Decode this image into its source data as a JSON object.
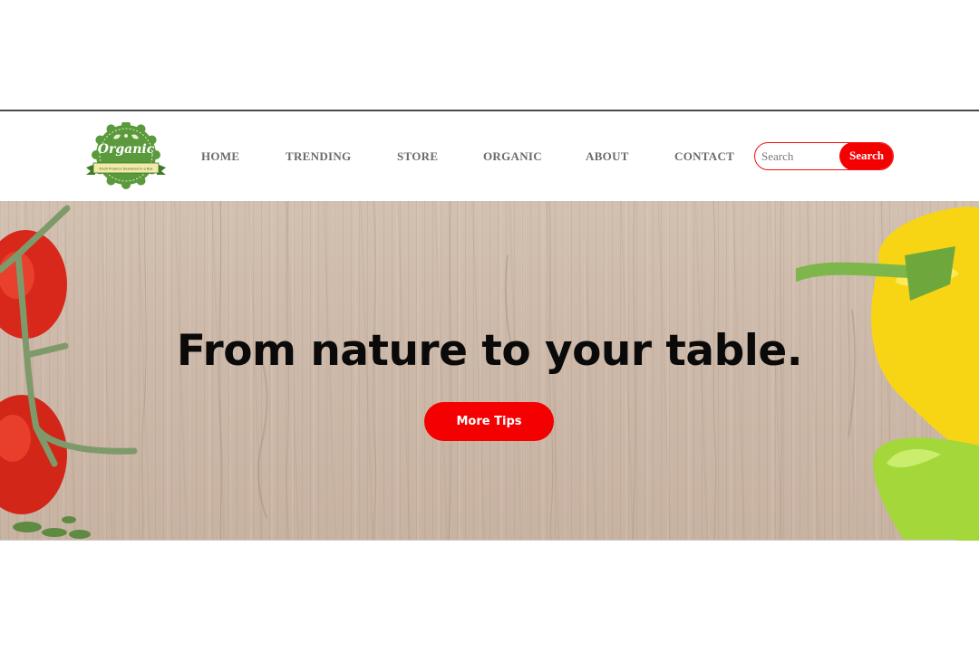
{
  "brand": {
    "logo_text": "Organic",
    "logo_tagline": "Fresh Produce Delivered in a Box"
  },
  "nav": {
    "items": [
      {
        "label": "HOME"
      },
      {
        "label": "TRENDING"
      },
      {
        "label": "STORE"
      },
      {
        "label": "ORGANIC"
      },
      {
        "label": "ABOUT"
      },
      {
        "label": "CONTACT"
      }
    ]
  },
  "search": {
    "placeholder": "Search",
    "button_label": "Search"
  },
  "hero": {
    "headline": "From nature to your table.",
    "cta_label": "More Tips"
  },
  "colors": {
    "accent": "#f40000",
    "nav_text": "#6b6b6b",
    "logo_green": "#5a9a3c",
    "wood": "#cdb9a9"
  }
}
